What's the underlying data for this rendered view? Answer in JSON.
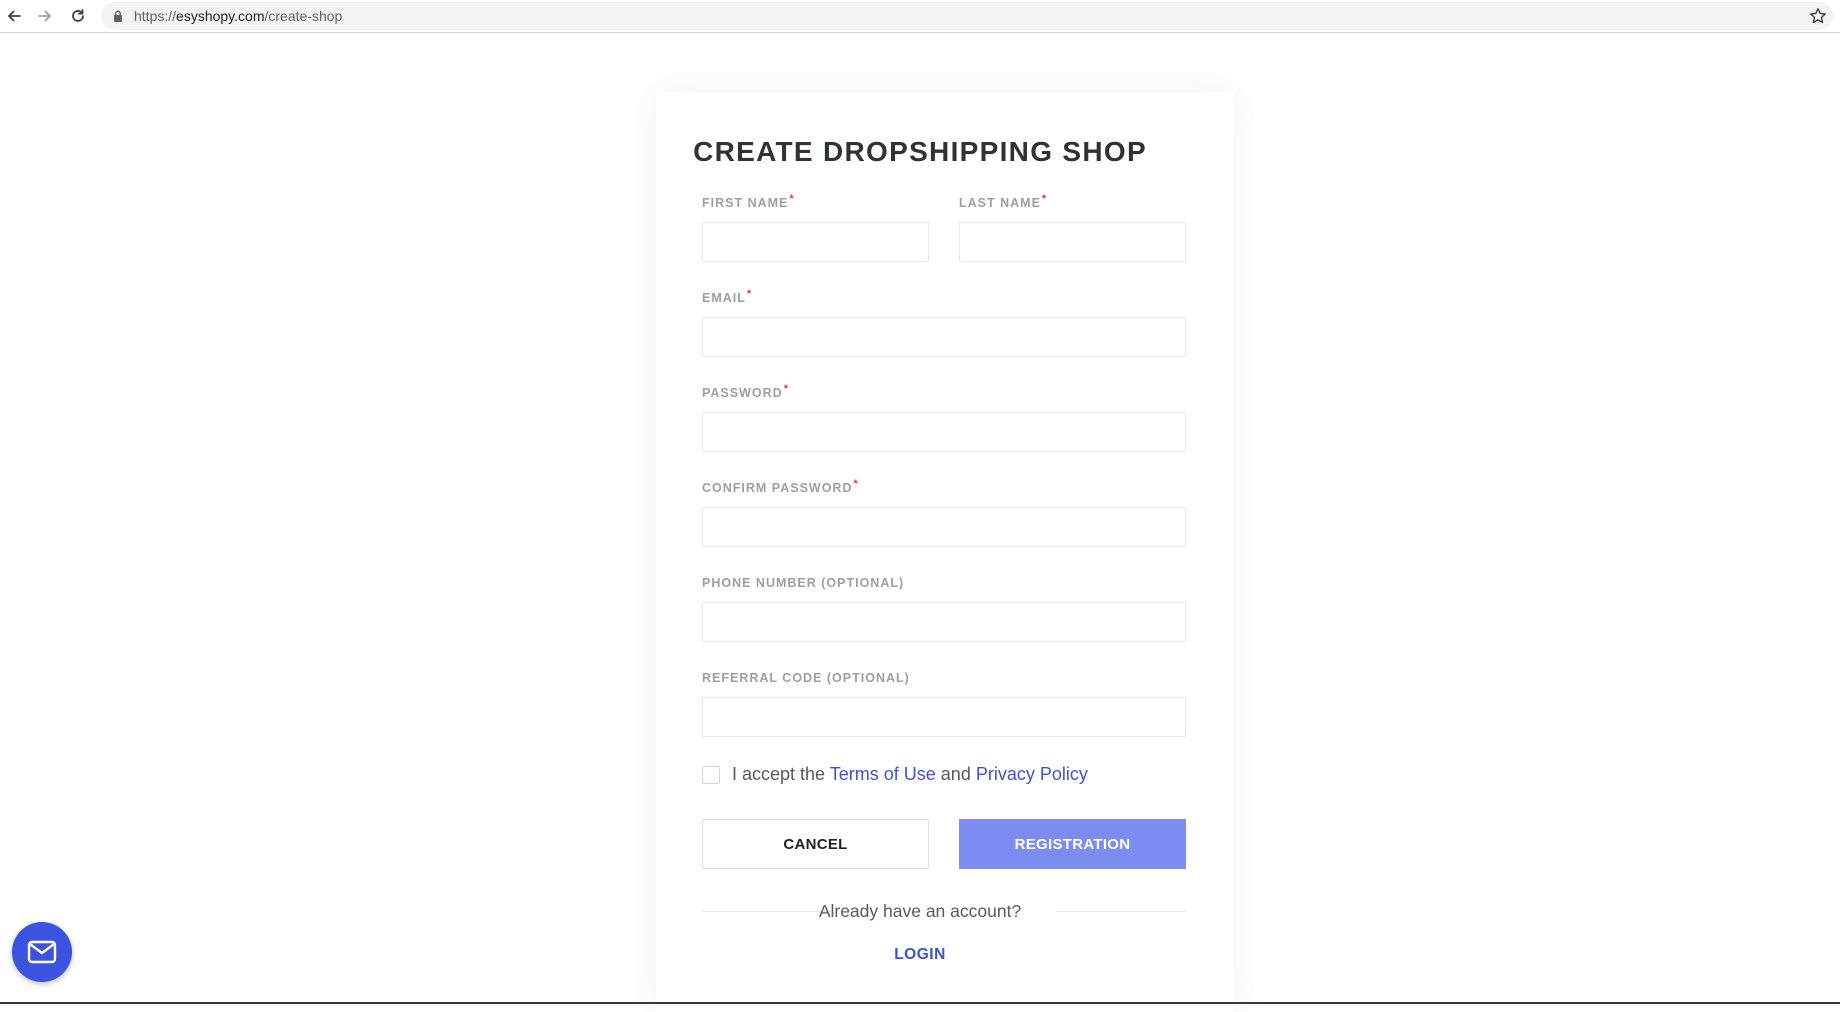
{
  "browser": {
    "url_scheme": "https://",
    "url_host": "esyshopy.com",
    "url_path": "/create-shop",
    "icons": [
      "back-arrow-icon",
      "forward-arrow-icon",
      "reload-icon",
      "lock-icon",
      "bookmark-star-icon"
    ]
  },
  "form": {
    "title": "CREATE DROPSHIPPING SHOP",
    "required_marker": "*",
    "fields": {
      "first_name": {
        "label": "FIRST NAME",
        "value": ""
      },
      "last_name": {
        "label": "LAST NAME",
        "value": ""
      },
      "email": {
        "label": "EMAIL",
        "value": ""
      },
      "password": {
        "label": "PASSWORD",
        "value": ""
      },
      "confirm_password": {
        "label": "CONFIRM PASSWORD",
        "value": ""
      },
      "phone": {
        "label": "PHONE NUMBER (OPTIONAL)",
        "value": ""
      },
      "referral": {
        "label": "REFERRAL CODE (OPTIONAL)",
        "value": ""
      }
    },
    "terms": {
      "checked": false,
      "prefix": "I accept the",
      "terms_link": "Terms of Use",
      "and": "and",
      "privacy_link": "Privacy Policy"
    },
    "cancel_label": "CANCEL",
    "register_label": "REGISTRATION",
    "already_text": "Already have an account?",
    "login_label": "LOGIN"
  },
  "chat": {
    "icon": "envelope-icon",
    "color": "#3c52e0"
  },
  "colors": {
    "accent": "#7d8cf1",
    "link": "#4050d8",
    "required": "#e0384b",
    "title": "#2f3336"
  }
}
